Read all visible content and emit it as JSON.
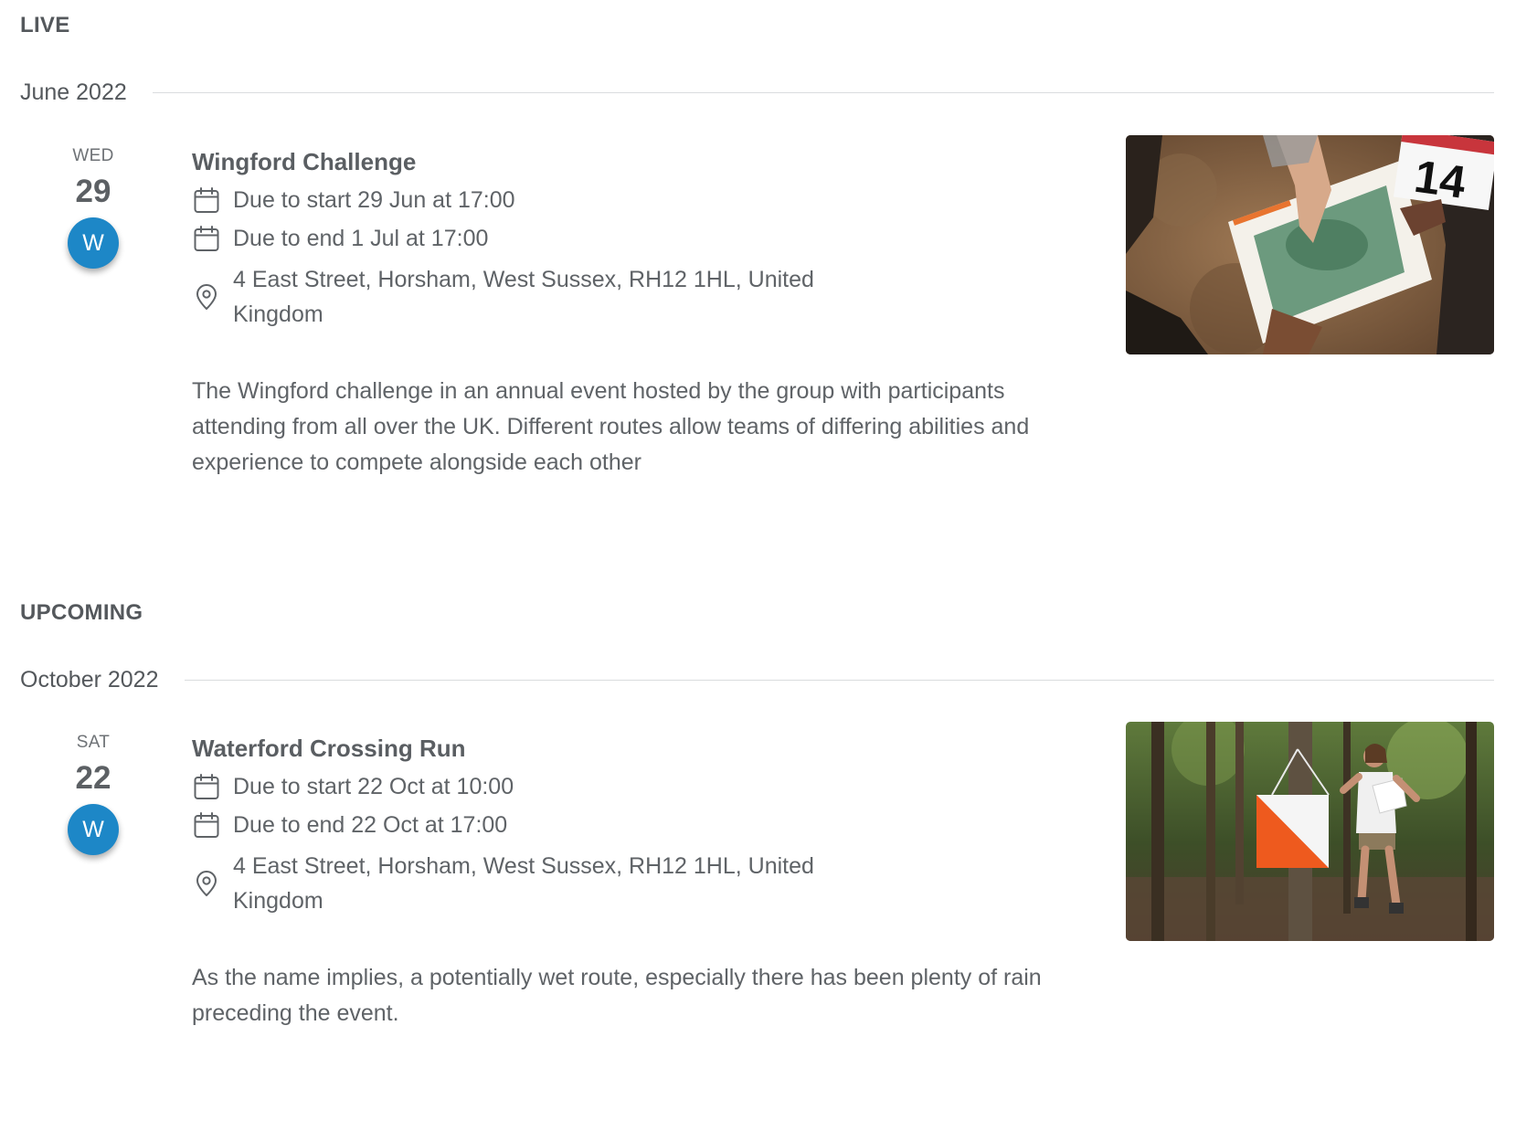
{
  "sections": [
    {
      "heading": "LIVE",
      "month": "June 2022",
      "event": {
        "weekday": "WED",
        "day": "29",
        "avatar_letter": "W",
        "title": "Wingford Challenge",
        "start": "Due to start 29 Jun at 17:00",
        "end": "Due to end 1 Jul at 17:00",
        "location": "4 East Street, Horsham, West Sussex, RH12 1HL, United Kingdom",
        "description": "The Wingford challenge in an annual event hosted by the group with participants attending from all over the UK. Different routes allow teams of differing abilities and experience to compete alongside each other",
        "image_badge": "14"
      }
    },
    {
      "heading": "UPCOMING",
      "month": "October 2022",
      "event": {
        "weekday": "SAT",
        "day": "22",
        "avatar_letter": "W",
        "title": "Waterford Crossing Run",
        "start": "Due to start 22 Oct at 10:00",
        "end": "Due to end 22 Oct at 17:00",
        "location": "4 East Street, Horsham, West Sussex, RH12 1HL, United Kingdom",
        "description": "As the name implies, a potentially wet route, especially there has been plenty of rain preceding the event."
      }
    }
  ],
  "colors": {
    "avatar": "#1d87c7",
    "text": "#5f6367",
    "rule": "#dadcde"
  }
}
